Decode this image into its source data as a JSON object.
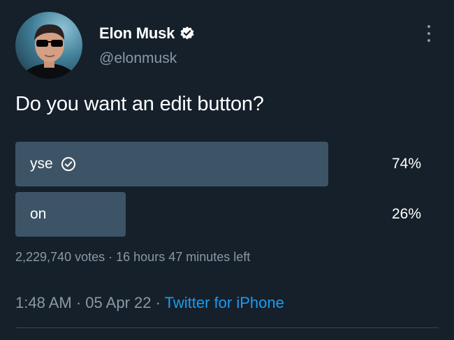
{
  "author": {
    "name": "Elon Musk",
    "handle": "@elonmusk",
    "verified": true
  },
  "tweet": {
    "question": "Do you want an edit button?"
  },
  "poll": {
    "options": [
      {
        "label": "yse",
        "percent_text": "74%",
        "percent": 74,
        "selected": true
      },
      {
        "label": "on",
        "percent_text": "26%",
        "percent": 26,
        "selected": false
      }
    ],
    "votes": "2,229,740 votes",
    "separator": "·",
    "time_left": "16 hours 47 minutes left"
  },
  "meta": {
    "time": "1:48 AM",
    "dot1": "·",
    "date": "05 Apr 22",
    "dot2": "·",
    "source": "Twitter for iPhone"
  },
  "colors": {
    "background": "#15202b",
    "poll_bar": "#3d5466",
    "secondary_text": "#8b98a5",
    "link": "#1d9bf0"
  },
  "icons": {
    "verified": "verified-badge-icon",
    "selected": "check-circle-icon",
    "more": "more-vertical-icon"
  }
}
